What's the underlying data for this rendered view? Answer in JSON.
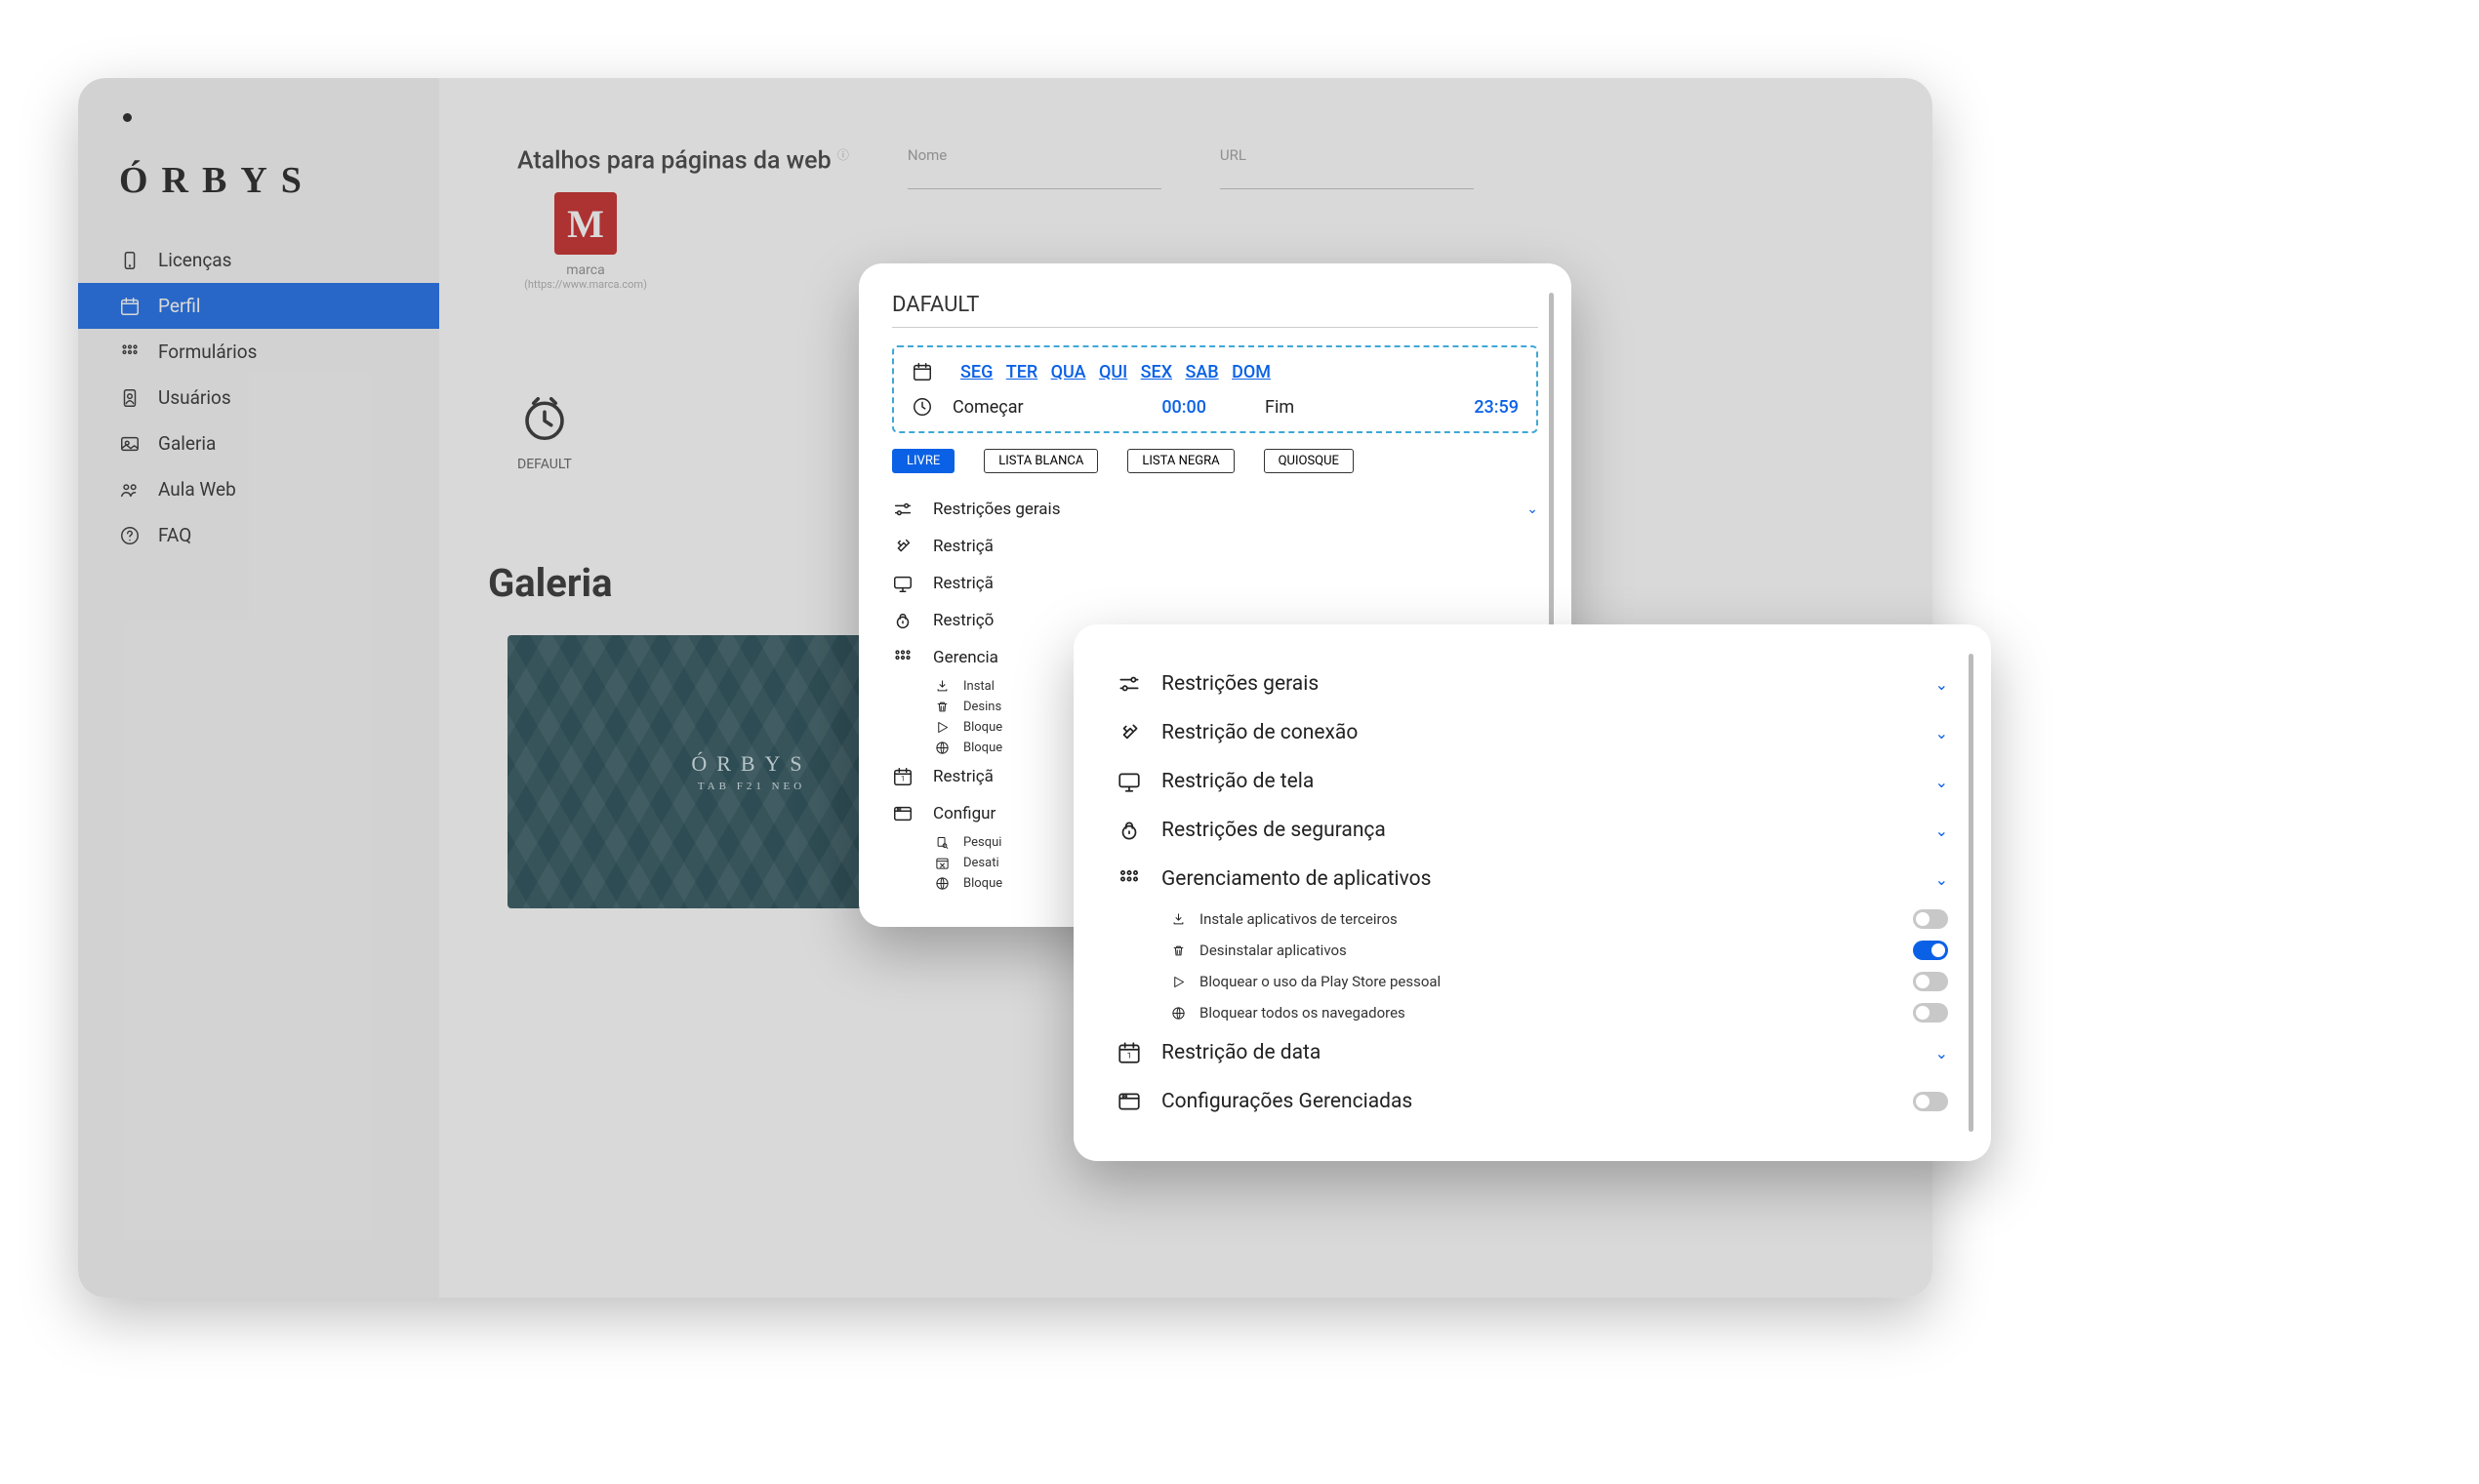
{
  "brand": "ÓRBYS",
  "sidebar": {
    "items": [
      {
        "label": "Licenças",
        "icon": "phone"
      },
      {
        "label": "Perfil",
        "icon": "calendar",
        "active": true
      },
      {
        "label": "Formulários",
        "icon": "grid"
      },
      {
        "label": "Usuários",
        "icon": "badge"
      },
      {
        "label": "Galeria",
        "icon": "image"
      },
      {
        "label": "Aula Web",
        "icon": "people"
      },
      {
        "label": "FAQ",
        "icon": "question"
      }
    ]
  },
  "shortcuts": {
    "title": "Atalhos para páginas da web",
    "name_label": "Nome",
    "url_label": "URL",
    "item": {
      "name": "marca",
      "url": "(https://www.marca.com)"
    }
  },
  "profile_tile": {
    "label": "DEFAULT"
  },
  "gallery": {
    "heading": "Galeria",
    "tile_brand": "ÓRBYS",
    "tile_model": "TAB F21 NEO"
  },
  "panel1": {
    "name": "DAFAULT",
    "days": [
      "SEG",
      "TER",
      "QUA",
      "QUI",
      "SEX",
      "SAB",
      "DOM"
    ],
    "start_label": "Começar",
    "start_val": "00:00",
    "end_label": "Fim",
    "end_val": "23:59",
    "chips": [
      "LIVRE",
      "LISTA BLANCA",
      "LISTA NEGRA",
      "QUIOSQUE"
    ],
    "acc": [
      {
        "label": "Restrições gerais",
        "icon": "sliders",
        "chev": true
      },
      {
        "label": "Restriçã",
        "icon": "plug"
      },
      {
        "label": "Restriçã",
        "icon": "monitor"
      },
      {
        "label": "Restriçõ",
        "icon": "lock"
      },
      {
        "label": "Gerencia",
        "icon": "grid",
        "chev": true
      }
    ],
    "subs": [
      {
        "label": "Instal",
        "icon": "download"
      },
      {
        "label": "Desins",
        "icon": "trash"
      },
      {
        "label": "Bloque",
        "icon": "play"
      },
      {
        "label": "Bloque",
        "icon": "globe"
      }
    ],
    "tail": [
      {
        "label": "Restriçã",
        "icon": "date"
      },
      {
        "label": "Configur",
        "icon": "browser"
      }
    ],
    "tail_subs": [
      {
        "label": "Pesqui",
        "icon": "search-doc"
      },
      {
        "label": "Desati",
        "icon": "cal-x"
      },
      {
        "label": "Bloque",
        "icon": "globe"
      }
    ]
  },
  "panel2": {
    "rows": [
      {
        "label": "Restrições gerais",
        "icon": "sliders",
        "chev": true
      },
      {
        "label": "Restrição de conexão",
        "icon": "plug",
        "chev": true
      },
      {
        "label": "Restrição de tela",
        "icon": "monitor",
        "chev": true
      },
      {
        "label": "Restrições de segurança",
        "icon": "lock",
        "chev": true
      },
      {
        "label": "Gerenciamento de aplicativos",
        "icon": "grid",
        "chev": true
      }
    ],
    "subs": [
      {
        "label": "Instale aplicativos de terceiros",
        "icon": "download",
        "on": false
      },
      {
        "label": "Desinstalar aplicativos",
        "icon": "trash",
        "on": true
      },
      {
        "label": "Bloquear o uso da Play Store pessoal",
        "icon": "play",
        "on": false
      },
      {
        "label": "Bloquear todos os navegadores",
        "icon": "globe",
        "on": false
      }
    ],
    "tail": [
      {
        "label": "Restrição de data",
        "icon": "date",
        "chev": true
      },
      {
        "label": "Configurações Gerenciadas",
        "icon": "browser",
        "toggle": true,
        "on": false
      }
    ]
  }
}
